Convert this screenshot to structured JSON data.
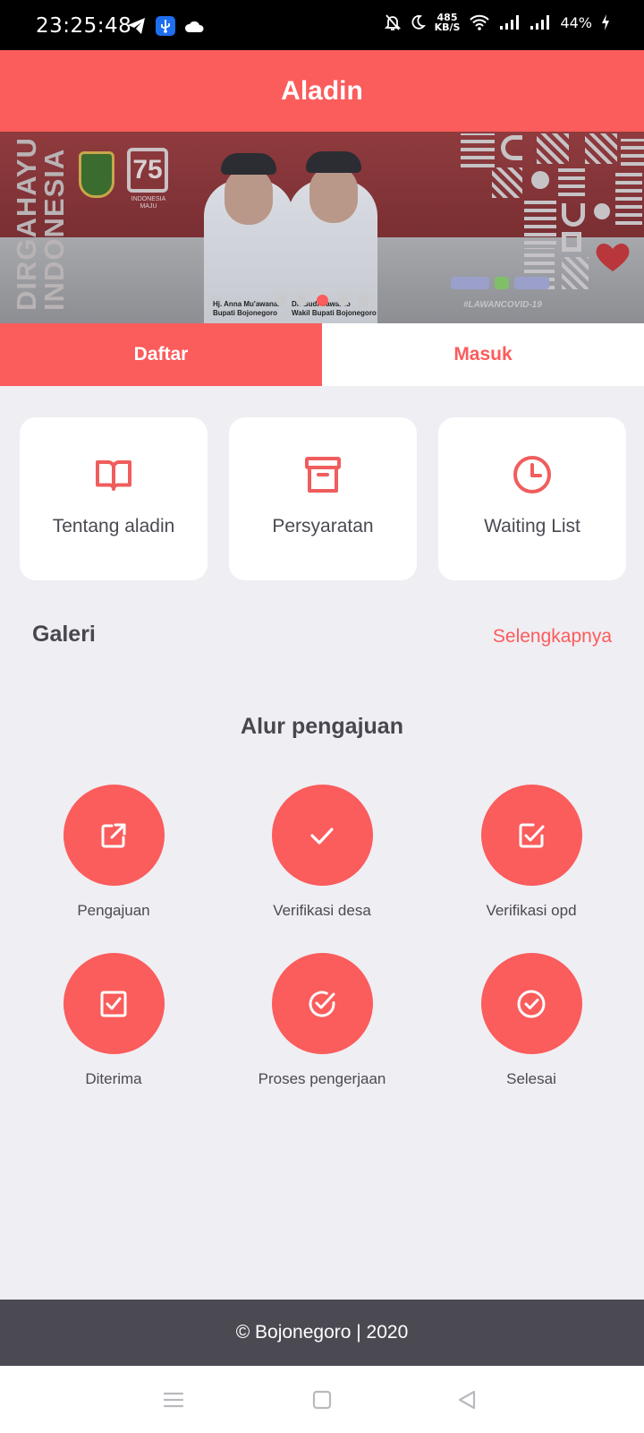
{
  "status_bar": {
    "time": "23:25:48",
    "net_speed_top": "485",
    "net_speed_bottom": "KB/S",
    "battery": "44%",
    "icons_left": [
      "telegram-icon",
      "usb-icon",
      "cloud-icon"
    ],
    "icons_right": [
      "mute-icon",
      "moon-icon",
      "wifi-icon",
      "signal-icon",
      "signal-icon",
      "charging-icon"
    ]
  },
  "app": {
    "title": "Aladin",
    "accent": "#fb5c5c"
  },
  "banner": {
    "vertical_text_1": "DIRGAHAYU",
    "vertical_text_2": "INDONESIA",
    "logo_number": "75",
    "logo_caption": "INDONESIA MAJU",
    "caption_left_1": "Hj. Anna Mu'awanah",
    "caption_left_2": "Bupati Bojonegoro",
    "caption_right_1": "Dr. Budi Irawanto",
    "caption_right_2": "Wakil Bupati Bojonegoro",
    "hashtag": "#LAWANCOVID-19",
    "slide_count": 5,
    "active_slide": 3
  },
  "tabs": {
    "register": "Daftar",
    "login": "Masuk"
  },
  "cards": [
    {
      "label": "Tentang aladin",
      "icon": "book-icon"
    },
    {
      "label": "Persyaratan",
      "icon": "archive-icon"
    },
    {
      "label": "Waiting List",
      "icon": "clock-icon"
    }
  ],
  "galeri": {
    "title": "Galeri",
    "more": "Selengkapnya"
  },
  "alur": {
    "title": "Alur pengajuan",
    "steps": [
      {
        "label": "Pengajuan",
        "icon": "external-link-icon"
      },
      {
        "label": "Verifikasi desa",
        "icon": "check-icon"
      },
      {
        "label": "Verifikasi opd",
        "icon": "edit-check-icon"
      },
      {
        "label": "Diterima",
        "icon": "checkbox-icon"
      },
      {
        "label": "Proses pengerjaan",
        "icon": "check-circle-open-icon"
      },
      {
        "label": "Selesai",
        "icon": "check-circle-icon"
      }
    ]
  },
  "footer": {
    "text": "© Bojonegoro | 2020"
  }
}
